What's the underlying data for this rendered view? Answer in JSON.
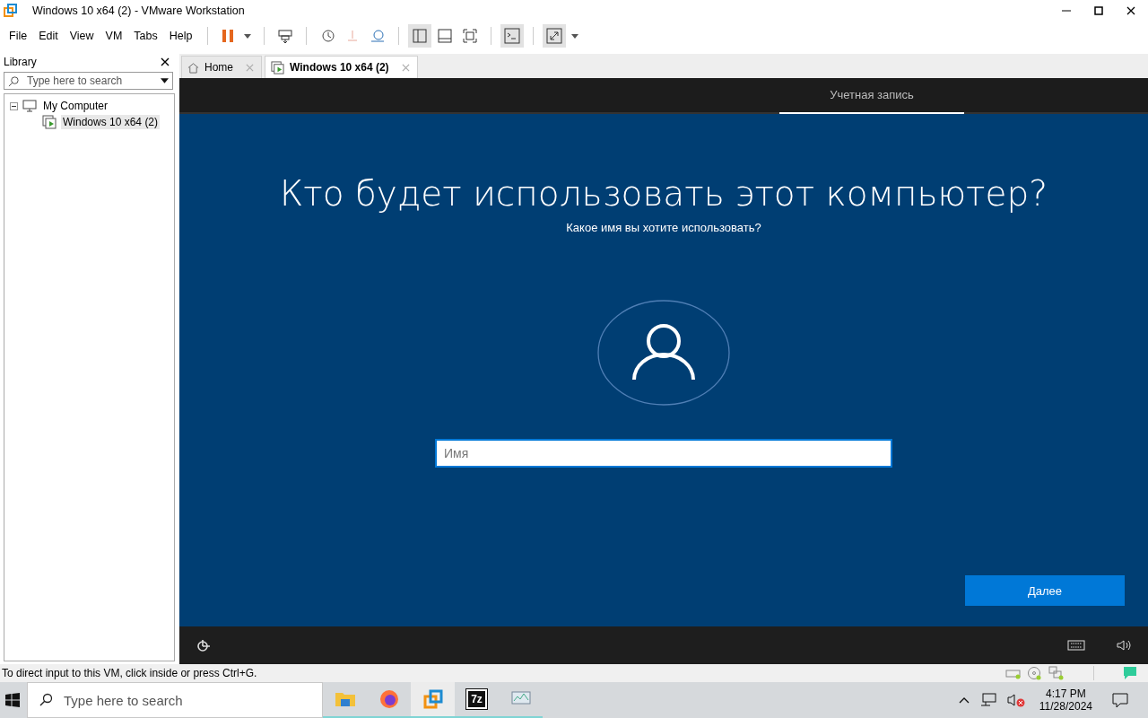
{
  "window": {
    "title": "Windows 10 x64 (2) - VMware Workstation"
  },
  "menu": [
    {
      "label": "File"
    },
    {
      "label": "Edit"
    },
    {
      "label": "View"
    },
    {
      "label": "VM"
    },
    {
      "label": "Tabs"
    },
    {
      "label": "Help"
    }
  ],
  "library": {
    "title": "Library",
    "search": {
      "placeholder": "Type here to search"
    },
    "tree": [
      {
        "label": "My Computer",
        "expanded": true,
        "children": [
          {
            "label": "Windows 10 x64 (2)",
            "selected": true
          }
        ]
      }
    ]
  },
  "tabs": [
    {
      "label": "Home",
      "kind": "home",
      "selected": false
    },
    {
      "label": "Windows 10 x64 (2)",
      "kind": "vm",
      "selected": true
    }
  ],
  "vm_screen": {
    "header_tab": "Учетная запись",
    "heading": "Кто будет использовать этот компьютер?",
    "subheading": "Какое имя вы хотите использовать?",
    "name_field": {
      "placeholder": "Имя"
    },
    "next_button": "Далее"
  },
  "status_bar": {
    "message": "To direct input to this VM, click inside or press Ctrl+G."
  },
  "taskbar": {
    "search": {
      "placeholder": "Type here to search"
    },
    "archiver_label": "7z",
    "time": "4:17 PM",
    "date": "11/28/2024"
  }
}
